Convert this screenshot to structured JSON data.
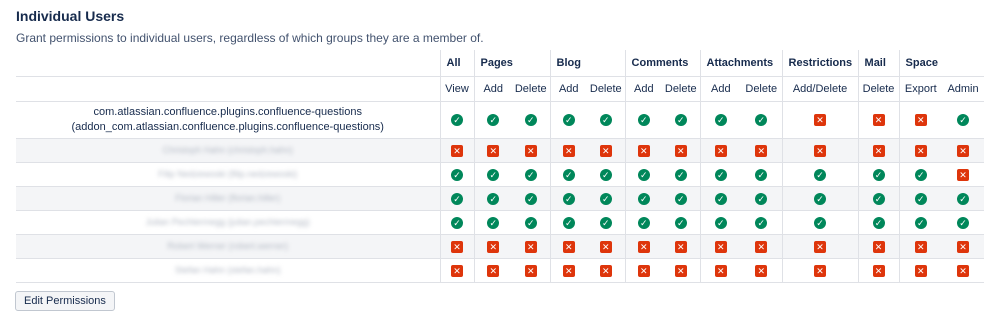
{
  "section": {
    "title": "Individual Users",
    "description": "Grant permissions to individual users, regardless of which groups they are a member of."
  },
  "groups": [
    {
      "label": "All",
      "span": 1
    },
    {
      "label": "Pages",
      "span": 2
    },
    {
      "label": "Blog",
      "span": 2
    },
    {
      "label": "Comments",
      "span": 2
    },
    {
      "label": "Attachments",
      "span": 2
    },
    {
      "label": "Restrictions",
      "span": 1
    },
    {
      "label": "Mail",
      "span": 1
    },
    {
      "label": "Space",
      "span": 2
    }
  ],
  "columns": [
    "View",
    "Add",
    "Delete",
    "Add",
    "Delete",
    "Add",
    "Delete",
    "Add",
    "Delete",
    "Add/Delete",
    "Delete",
    "Export",
    "Admin"
  ],
  "icons": {
    "granted": "check-circle-icon",
    "denied": "x-square-icon",
    "granted_color": "#00875a",
    "denied_color": "#de350b"
  },
  "users": [
    {
      "name_line1": "com.atlassian.confluence.plugins.confluence-questions",
      "name_line2": "(addon_com.atlassian.confluence.plugins.confluence-questions)",
      "blurred": false,
      "perms": [
        true,
        true,
        true,
        true,
        true,
        true,
        true,
        true,
        true,
        false,
        false,
        false,
        true
      ]
    },
    {
      "name_line1": "Christoph Hahn (christoph.hahn)",
      "name_line2": "",
      "blurred": true,
      "perms": [
        false,
        false,
        false,
        false,
        false,
        false,
        false,
        false,
        false,
        false,
        false,
        false,
        false
      ]
    },
    {
      "name_line1": "Filip Nedzewoski (filip.nedzewoski)",
      "name_line2": "",
      "blurred": true,
      "perms": [
        true,
        true,
        true,
        true,
        true,
        true,
        true,
        true,
        true,
        true,
        true,
        true,
        false
      ]
    },
    {
      "name_line1": "Florian Hiller (florian.hiller)",
      "name_line2": "",
      "blurred": true,
      "perms": [
        true,
        true,
        true,
        true,
        true,
        true,
        true,
        true,
        true,
        true,
        true,
        true,
        true
      ]
    },
    {
      "name_line1": "Julian Pechtermegg (julian.pechtermegg)",
      "name_line2": "",
      "blurred": true,
      "perms": [
        true,
        true,
        true,
        true,
        true,
        true,
        true,
        true,
        true,
        true,
        true,
        true,
        true
      ]
    },
    {
      "name_line1": "Robert Werner (robert.werner)",
      "name_line2": "",
      "blurred": true,
      "perms": [
        false,
        false,
        false,
        false,
        false,
        false,
        false,
        false,
        false,
        false,
        false,
        false,
        false
      ]
    },
    {
      "name_line1": "Stefan Hahn (stefan.hahn)",
      "name_line2": "",
      "blurred": true,
      "perms": [
        false,
        false,
        false,
        false,
        false,
        false,
        false,
        false,
        false,
        false,
        false,
        false,
        false
      ]
    }
  ],
  "edit_button": {
    "label": "Edit Permissions"
  }
}
